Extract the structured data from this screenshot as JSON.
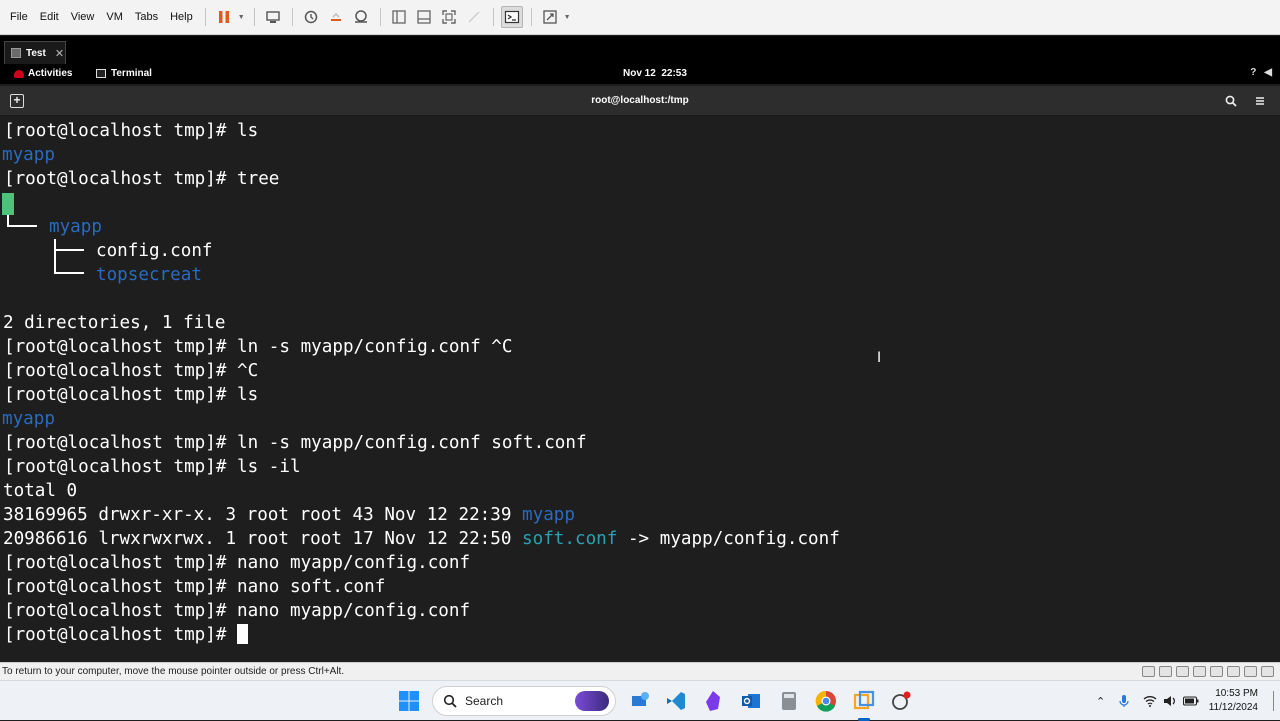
{
  "vmware": {
    "menu": [
      "File",
      "Edit",
      "View",
      "VM",
      "Tabs",
      "Help"
    ],
    "toolbar_icons": [
      "pause-icon",
      "send-ctrl-alt-del-icon",
      "snapshot-icon",
      "revert-snapshot-icon",
      "snapshot-manager-icon",
      "sidebar-icon",
      "thumbnail-icon",
      "fullscreen-icon",
      "unity-icon",
      "console-icon",
      "stretch-icon"
    ],
    "tab": {
      "label": "Test"
    },
    "status_text": "To return to your computer, move the mouse pointer outside or press Ctrl+Alt."
  },
  "gnome": {
    "activities": "Activities",
    "app": "Terminal",
    "clock": "Nov 12  22:53"
  },
  "terminal": {
    "title": "root@localhost:/tmp",
    "lines": {
      "l1": "[root@localhost tmp]# ls",
      "l2": "myapp",
      "l3": "[root@localhost tmp]# tree",
      "l4": "myapp",
      "l5": "config.conf",
      "l6": "topsecreat",
      "l7": "2 directories, 1 file",
      "l8": "[root@localhost tmp]# ln -s myapp/config.conf ^C",
      "l9": "[root@localhost tmp]# ^C",
      "l10": "[root@localhost tmp]# ls",
      "l11": "myapp",
      "l12": "[root@localhost tmp]# ln -s myapp/config.conf soft.conf",
      "l13": "[root@localhost tmp]# ls -il",
      "l14": "total 0",
      "l15a": "38169965 drwxr-xr-x. 3 root root 43 Nov 12 22:39 ",
      "l15b": "myapp",
      "l16a": "20986616 lrwxrwxrwx. 1 root root 17 Nov 12 22:50 ",
      "l16b": "soft.conf",
      "l16c": " -> myapp/config.conf",
      "l17": "[root@localhost tmp]# nano myapp/config.conf",
      "l18": "[root@localhost tmp]# nano soft.conf",
      "l19": "[root@localhost tmp]# nano myapp/config.conf",
      "l20": "[root@localhost tmp]# "
    }
  },
  "windows": {
    "search_label": "Search",
    "time": "10:53 PM",
    "date": "11/12/2024",
    "colors": {
      "accent": "#0a64c8"
    }
  }
}
